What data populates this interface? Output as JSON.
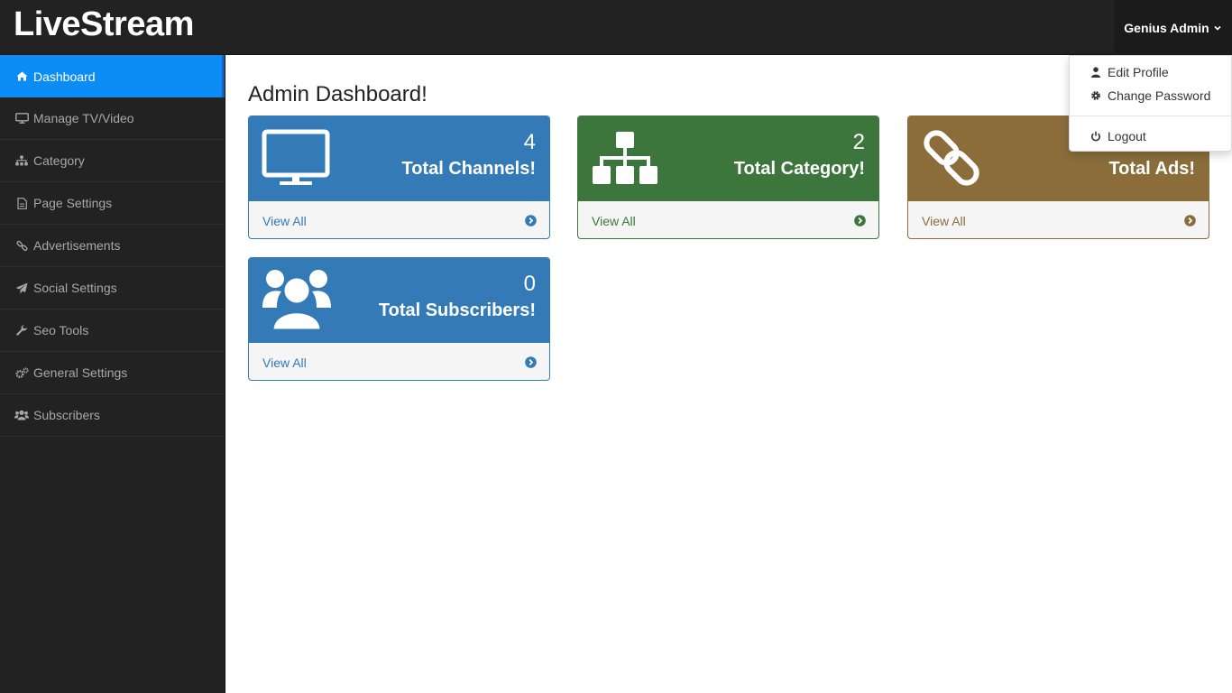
{
  "brand": "LiveStream",
  "user_menu": {
    "label": "Genius Admin"
  },
  "dropdown": {
    "items": [
      {
        "label": "Edit Profile",
        "icon": "user-icon"
      },
      {
        "label": "Change Password",
        "icon": "gear-icon"
      },
      {
        "label": "Logout",
        "icon": "power-icon"
      }
    ]
  },
  "sidebar": {
    "items": [
      {
        "label": "Dashboard",
        "icon": "home-icon",
        "active": true
      },
      {
        "label": "Manage TV/Video",
        "icon": "monitor-icon"
      },
      {
        "label": "Category",
        "icon": "sitemap-icon"
      },
      {
        "label": "Page Settings",
        "icon": "file-icon"
      },
      {
        "label": "Advertisements",
        "icon": "link-icon"
      },
      {
        "label": "Social Settings",
        "icon": "paper-plane-icon"
      },
      {
        "label": "Seo Tools",
        "icon": "wrench-icon"
      },
      {
        "label": "General Settings",
        "icon": "gears-icon"
      },
      {
        "label": "Subscribers",
        "icon": "users-icon"
      }
    ]
  },
  "main": {
    "title": "Admin Dashboard!",
    "cards": [
      {
        "count": "4",
        "label": "Total Channels!",
        "link": "View All",
        "icon": "monitor-icon",
        "color": "#337ab7"
      },
      {
        "count": "2",
        "label": "Total Category!",
        "link": "View All",
        "icon": "sitemap-icon",
        "color": "#3c763d"
      },
      {
        "count": "",
        "label": "Total Ads!",
        "link": "View All",
        "icon": "link-icon",
        "color": "#8a6d3b"
      },
      {
        "count": "0",
        "label": "Total Subscribers!",
        "link": "View All",
        "icon": "users-icon",
        "color": "#337ab7"
      }
    ]
  }
}
